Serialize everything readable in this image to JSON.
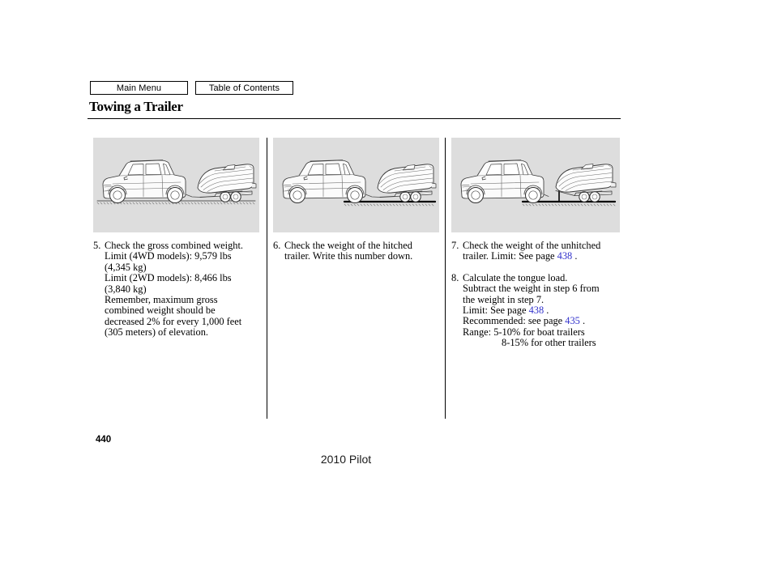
{
  "nav": {
    "main_menu_label": "Main Menu",
    "table_of_contents_label": "Table of Contents"
  },
  "header": {
    "title": "Towing a Trailer"
  },
  "colors": {
    "link": "#3333cc",
    "figure_background": "#dddddd",
    "text": "#000000"
  },
  "columns": [
    {
      "figure": {
        "name": "suv-towing-boat-trailer-hitched-on-road",
        "alt": "SUV towing a boat on a trailer along a road surface"
      },
      "steps": [
        {
          "number": "5.",
          "lines": [
            "Check the gross combined weight.",
            "Limit (4WD models): 9,579 lbs",
            "(4,345 kg)",
            "Limit (2WD models): 8,466 lbs",
            "(3,840 kg)",
            "Remember, maximum gross",
            "combined weight should be",
            "decreased 2% for every 1,000 feet",
            "(305 meters) of elevation."
          ]
        }
      ]
    },
    {
      "figure": {
        "name": "suv-towing-boat-trailer-on-scale-hitched",
        "alt": "SUV with hitched boat trailer, trailer wheels resting on a weighing scale"
      },
      "steps": [
        {
          "number": "6.",
          "lines": [
            "Check the weight of the hitched",
            "trailer. Write this number down."
          ]
        }
      ]
    },
    {
      "figure": {
        "name": "boat-trailer-unhitched-on-scale",
        "alt": "Boat trailer unhitched from SUV with tongue jack on a weighing scale"
      },
      "steps": [
        {
          "number": "7.",
          "lines": [
            "Check the weight of the unhitched",
            "trailer. Limit: See page 438 ."
          ]
        },
        {
          "number": "8.",
          "lines": [
            "Calculate the tongue load.",
            "Subtract the weight in step 6 from",
            "the weight in step 7.",
            "Limit: See page 438 .",
            "Recommended: see page 435 .",
            "Range: 5-10% for boat trailers",
            "8-15% for other trailers"
          ]
        }
      ]
    }
  ],
  "links": {
    "step7_limit_page": "438",
    "step8_limit_page": "438",
    "step8_recommended_page": "435"
  },
  "step_text": {
    "s5_l1": "Check the gross combined weight.",
    "s5_l2": "Limit (4WD models): 9,579 lbs",
    "s5_l3": "(4,345 kg)",
    "s5_l4": "Limit (2WD models): 8,466 lbs",
    "s5_l5": "(3,840 kg)",
    "s5_l6": "Remember, maximum gross",
    "s5_l7": "combined weight should be",
    "s5_l8": "decreased 2% for every 1,000 feet",
    "s5_l9": "(305 meters) of elevation.",
    "s6_l1": "Check the weight of the hitched",
    "s6_l2": "trailer. Write this number down.",
    "s7_l1": "Check the weight of the unhitched",
    "s7_l2a": "trailer. Limit: See page ",
    "s7_l2b": " .",
    "s8_l1": "Calculate the tongue load.",
    "s8_l2": "Subtract the weight in step 6 from",
    "s8_l3": "the weight in step 7.",
    "s8_l4a": "Limit: See page ",
    "s8_l4b": " .",
    "s8_l5a": "Recommended: see page ",
    "s8_l5b": " .",
    "s8_l6": "Range: 5-10% for boat trailers",
    "s8_l7": "8-15% for other trailers"
  },
  "numbers": {
    "step5": "5.",
    "step6": "6.",
    "step7": "7.",
    "step8": "8."
  },
  "footer": {
    "page_number": "440",
    "model": "2010 Pilot"
  }
}
